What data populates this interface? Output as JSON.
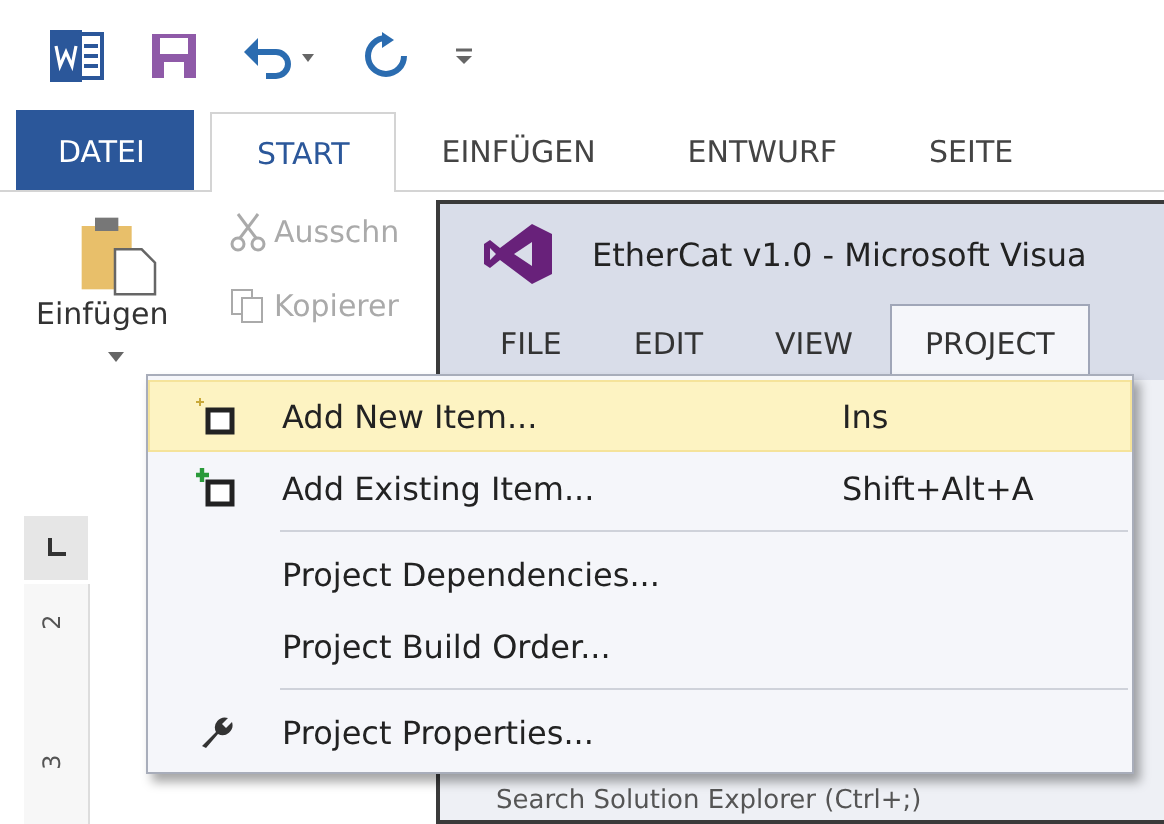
{
  "word": {
    "ribbon_tabs": [
      {
        "label": "DATEI",
        "kind": "file",
        "selected": false
      },
      {
        "label": "START",
        "kind": "tab",
        "selected": true
      },
      {
        "label": "EINFÜGEN",
        "kind": "tab",
        "selected": false
      },
      {
        "label": "ENTWURF",
        "kind": "tab",
        "selected": false
      },
      {
        "label": "SEITE",
        "kind": "tab",
        "selected": false
      }
    ],
    "clipboard": {
      "paste": "Einfügen",
      "cut": "Ausschn",
      "copy": "Kopierer"
    },
    "ruler": [
      "2",
      "3"
    ]
  },
  "vs_window": {
    "title": "EtherCat v1.0 - Microsoft Visua",
    "menu": [
      {
        "label": "FILE",
        "selected": false
      },
      {
        "label": "EDIT",
        "selected": false
      },
      {
        "label": "VIEW",
        "selected": false
      },
      {
        "label": "PROJECT",
        "selected": true
      }
    ],
    "search_placeholder": "Search Solution Explorer (Ctrl+;)"
  },
  "context_menu": [
    {
      "kind": "new",
      "label": "Add New Item...",
      "shortcut": "Ins",
      "selected": true
    },
    {
      "kind": "existing",
      "label": "Add Existing Item...",
      "shortcut": "Shift+Alt+A",
      "selected": false
    },
    {
      "kind": "separator"
    },
    {
      "kind": "plain",
      "label": "Project Dependencies...",
      "selected": false
    },
    {
      "kind": "plain",
      "label": "Project Build Order...",
      "selected": false
    },
    {
      "kind": "separator"
    },
    {
      "kind": "settings",
      "label": "Project Properties...",
      "selected": false
    }
  ]
}
